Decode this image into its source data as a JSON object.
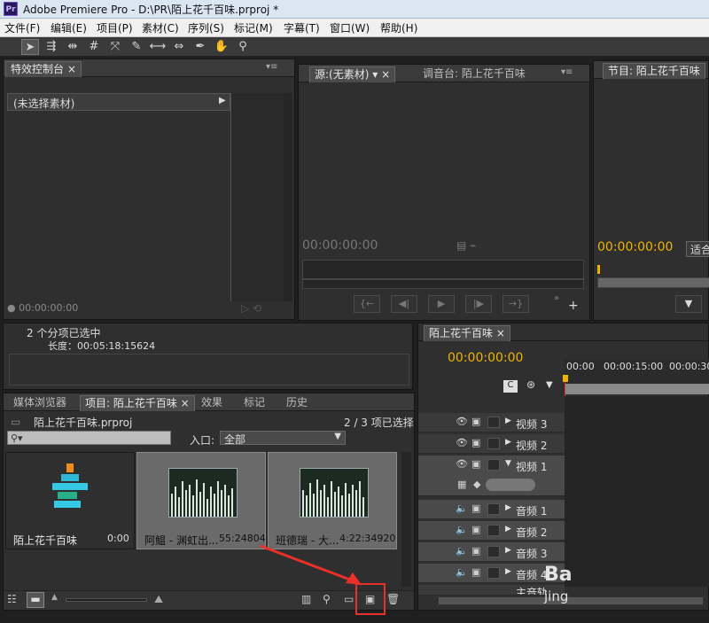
{
  "window": {
    "app_icon_text": "Pr",
    "title": "Adobe Premiere Pro - D:\\PR\\陌上花千百味.prproj *"
  },
  "menu": [
    "文件(F)",
    "编辑(E)",
    "项目(P)",
    "素材(C)",
    "序列(S)",
    "标记(M)",
    "字幕(T)",
    "窗口(W)",
    "帮助(H)"
  ],
  "tools": [
    "selection-tool-icon",
    "track-select-tool-icon",
    "ripple-edit-tool-icon",
    "rolling-edit-tool-icon",
    "rate-stretch-tool-icon",
    "razor-tool-icon",
    "slip-tool-icon",
    "slide-tool-icon",
    "pen-tool-icon",
    "hand-tool-icon",
    "zoom-tool-icon"
  ],
  "effects_panel": {
    "tab": "特效控制台",
    "no_clip": "(未选择素材)",
    "timecode": "00:00:00:00"
  },
  "source_panel": {
    "tab_source": "源:(无素材)",
    "tab_mixer": "调音台: 陌上花千百味",
    "timecode": "00:00:00:00"
  },
  "program_panel": {
    "tab": "节目: 陌上花千百味",
    "timecode": "00:00:00:00",
    "fit": "适合"
  },
  "info_panel": {
    "selection": "2 个分项已选中",
    "duration": "长度：00:05:18:15624"
  },
  "project_panel": {
    "tabs": [
      "媒体浏览器",
      "项目: 陌上花千百味",
      "效果",
      "标记",
      "历史"
    ],
    "project_file": "陌上花千百味.prproj",
    "selection_count": "2 / 3 项已选择",
    "search_placeholder": "",
    "entry_label": "入口:",
    "entry_value": "全部",
    "items": [
      {
        "name": "陌上花千百味",
        "duration": "0:00"
      },
      {
        "name": "阿鳁 - 渊虹出...",
        "duration": "55:24804"
      },
      {
        "name": "班德瑞 - 大...",
        "duration": "4:22:34920"
      }
    ]
  },
  "timeline": {
    "tab": "陌上花千百味",
    "timecode": "00:00:00:00",
    "ruler": [
      "00:00",
      "00:00:15:00",
      "00:00:30"
    ],
    "video_tracks": [
      "视频 3",
      "视频 2",
      "视频 1"
    ],
    "audio_tracks": [
      "音频 1",
      "音频 2",
      "音频 3",
      "音频 4"
    ],
    "master_track": "主音轨"
  },
  "watermark": {
    "line1": "Ba",
    "line2": "jing"
  }
}
